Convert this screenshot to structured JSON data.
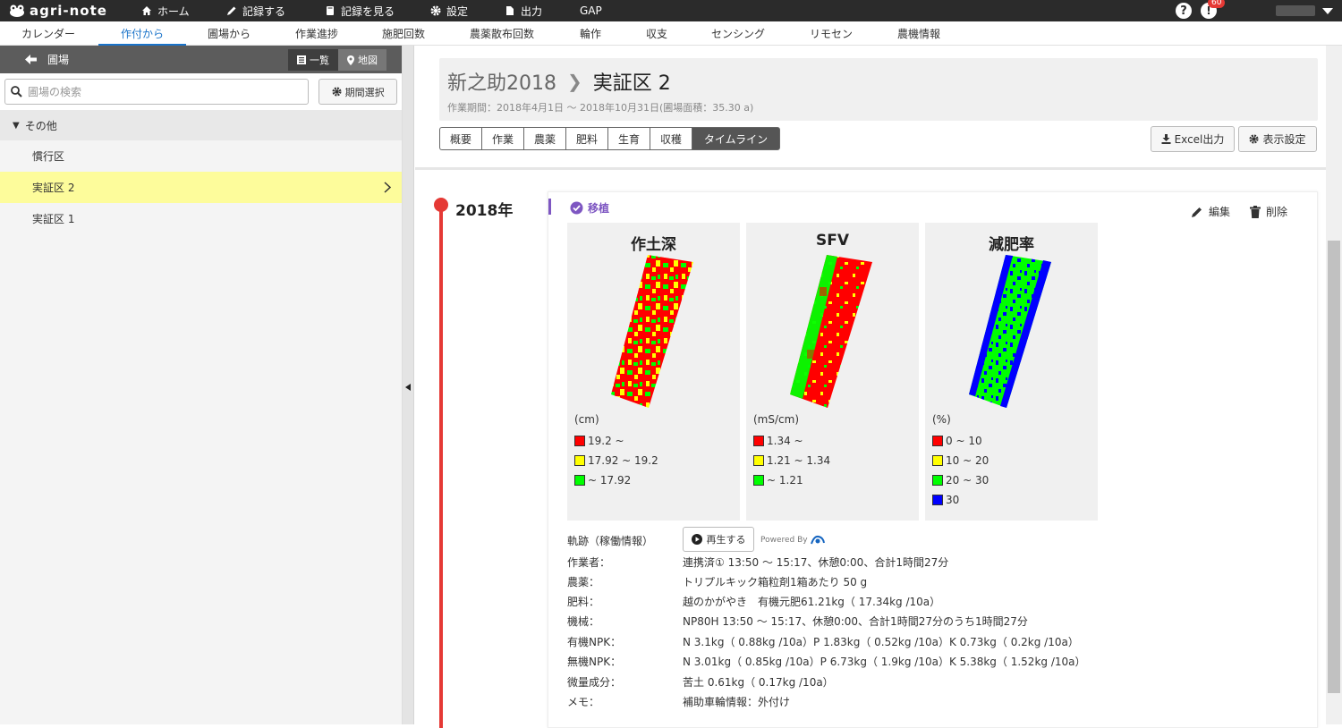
{
  "app": {
    "name": "agri-note"
  },
  "topnav": [
    {
      "label": "ホーム",
      "icon": "home-icon"
    },
    {
      "label": "記録する",
      "icon": "pencil-icon"
    },
    {
      "label": "記録を見る",
      "icon": "book-icon"
    },
    {
      "label": "設定",
      "icon": "gear-icon"
    },
    {
      "label": "出力",
      "icon": "file-icon"
    },
    {
      "label": "GAP",
      "icon": ""
    }
  ],
  "topright": {
    "help": "?",
    "notifications": "60"
  },
  "subnav": [
    "カレンダー",
    "作付から",
    "圃場から",
    "作業進捗",
    "施肥回数",
    "農薬散布回数",
    "輪作",
    "収支",
    "センシング",
    "リモセン",
    "農機情報"
  ],
  "subnav_active": "作付から",
  "sidebar": {
    "back_label": "圃場",
    "view_list": "一覧",
    "view_map": "地図",
    "search_placeholder": "圃場の検索",
    "period_button": "期間選択",
    "group": "その他",
    "fields": [
      "慣行区",
      "実証区 2",
      "実証区 1"
    ],
    "selected_field": "実証区 2"
  },
  "header": {
    "crop": "新之助2018",
    "field": "実証区 2",
    "period": "作業期間：2018年4月1日 ～ 2018年10月31日(圃場面積：35.30 a)"
  },
  "tabs": [
    "概要",
    "作業",
    "農薬",
    "肥料",
    "生育",
    "収穫",
    "タイムライン"
  ],
  "active_tab": "タイムライン",
  "buttons": {
    "excel": "Excel出力",
    "display_settings": "表示設定"
  },
  "timeline": {
    "year": "2018年",
    "entry": {
      "tag": "移植",
      "edit": "編集",
      "delete": "削除",
      "maps": [
        {
          "title": "作土深",
          "unit": "(cm)",
          "legend": [
            {
              "label": "19.2 ~",
              "color": "#ff0000"
            },
            {
              "label": "17.92 ~ 19.2",
              "color": "#ffff00"
            },
            {
              "label": "~ 17.92",
              "color": "#00ff00"
            }
          ]
        },
        {
          "title": "SFV",
          "unit": "(mS/cm)",
          "legend": [
            {
              "label": "1.34 ~",
              "color": "#ff0000"
            },
            {
              "label": "1.21 ~ 1.34",
              "color": "#ffff00"
            },
            {
              "label": "~ 1.21",
              "color": "#00ff00"
            }
          ]
        },
        {
          "title": "減肥率",
          "unit": "(%)",
          "legend": [
            {
              "label": "0 ~ 10",
              "color": "#ff0000"
            },
            {
              "label": "10 ~ 20",
              "color": "#ffff00"
            },
            {
              "label": "20 ~ 30",
              "color": "#00ff00"
            },
            {
              "label": "30",
              "color": "#0000ff"
            }
          ]
        }
      ],
      "track_label": "軌跡（稼働情報）",
      "play_button": "再生する",
      "powered_by": "Powered By",
      "details": [
        {
          "label": "作業者：",
          "value": "連携済① 13:50 ～ 15:17、休憩0:00、合計1時間27分"
        },
        {
          "label": "農薬：",
          "value": "トリプルキック箱粒剤1箱あたり 50 g"
        },
        {
          "label": "肥料：",
          "value": "越のかがやき　有機元肥61.21kg（ 17.34kg /10a）"
        },
        {
          "label": "機械：",
          "value": "NP80H 13:50 ～ 15:17、休憩0:00、合計1時間27分のうち1時間27分"
        },
        {
          "label": "有機NPK：",
          "value": "N 3.1kg（ 0.88kg /10a）P 1.83kg（ 0.52kg /10a）K 0.73kg（ 0.2kg /10a）"
        },
        {
          "label": "無機NPK：",
          "value": "N 3.01kg（ 0.85kg /10a）P 6.73kg（ 1.9kg /10a）K 5.38kg（ 1.52kg /10a）"
        },
        {
          "label": "微量成分：",
          "value": "苦土 0.61kg（ 0.17kg /10a）"
        },
        {
          "label": "メモ：",
          "value": "補助車輪情報：外付け"
        }
      ]
    }
  }
}
